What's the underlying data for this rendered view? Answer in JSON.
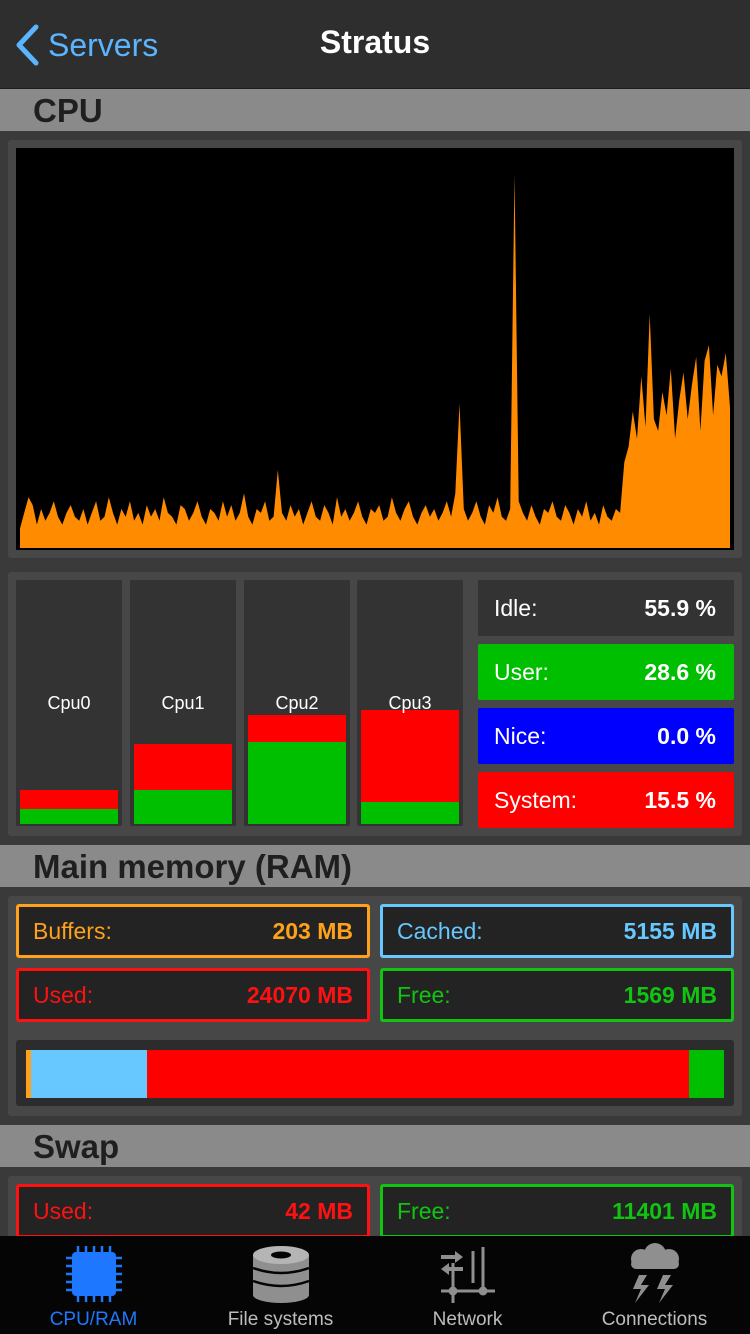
{
  "nav": {
    "back_label": "Servers",
    "title": "Stratus"
  },
  "sections": {
    "cpu": "CPU",
    "ram": "Main memory (RAM)",
    "swap": "Swap"
  },
  "cpu_chart": {
    "color": "#ff8c00",
    "samples": [
      5,
      9,
      13,
      11,
      6,
      10,
      7,
      9,
      12,
      8,
      6,
      9,
      11,
      8,
      7,
      10,
      6,
      9,
      12,
      7,
      8,
      13,
      9,
      6,
      10,
      8,
      12,
      7,
      9,
      6,
      11,
      8,
      10,
      7,
      13,
      9,
      8,
      6,
      11,
      10,
      7,
      9,
      12,
      8,
      6,
      10,
      9,
      7,
      12,
      8,
      11,
      7,
      9,
      14,
      8,
      6,
      10,
      9,
      12,
      7,
      8,
      20,
      9,
      7,
      11,
      8,
      10,
      6,
      9,
      12,
      8,
      7,
      11,
      9,
      6,
      13,
      8,
      10,
      7,
      9,
      12,
      8,
      6,
      10,
      9,
      11,
      7,
      8,
      13,
      9,
      7,
      10,
      12,
      8,
      6,
      9,
      11,
      8,
      10,
      7,
      9,
      12,
      8,
      14,
      37,
      10,
      7,
      9,
      12,
      8,
      6,
      11,
      9,
      13,
      8,
      7,
      10,
      96,
      12,
      9,
      7,
      11,
      8,
      6,
      10,
      9,
      12,
      8,
      7,
      11,
      9,
      6,
      10,
      8,
      12,
      7,
      9,
      6,
      11,
      8,
      7,
      10,
      9,
      22,
      26,
      35,
      28,
      44,
      31,
      60,
      33,
      30,
      40,
      34,
      46,
      28,
      38,
      45,
      33,
      42,
      49,
      30,
      48,
      52,
      34,
      47,
      44,
      50,
      36
    ],
    "max": 100
  },
  "cores": [
    {
      "name": "Cpu0",
      "user": 6,
      "system": 8
    },
    {
      "name": "Cpu1",
      "user": 14,
      "system": 19
    },
    {
      "name": "Cpu2",
      "user": 34,
      "system": 11
    },
    {
      "name": "Cpu3",
      "user": 9,
      "system": 38
    }
  ],
  "cpu_stats": [
    {
      "label": "Idle:",
      "value": "55.9 %",
      "bg": "#333333"
    },
    {
      "label": "User:",
      "value": "28.6 %",
      "bg": "#00bf00"
    },
    {
      "label": "Nice:",
      "value": "0.0 %",
      "bg": "#0000ff"
    },
    {
      "label": "System:",
      "value": "15.5 %",
      "bg": "#ff0000"
    }
  ],
  "ram": {
    "buffers": {
      "label": "Buffers:",
      "value": "203 MB",
      "color": "#ffa11a"
    },
    "cached": {
      "label": "Cached:",
      "value": "5155 MB",
      "color": "#66c8ff"
    },
    "used": {
      "label": "Used:",
      "value": "24070 MB",
      "color": "#ff1111"
    },
    "free": {
      "label": "Free:",
      "value": "1569 MB",
      "color": "#11c411"
    }
  },
  "ram_bar": [
    {
      "name": "buffers",
      "mb": 203,
      "color": "#ffa11a"
    },
    {
      "name": "cached",
      "mb": 5155,
      "color": "#66c8ff"
    },
    {
      "name": "used",
      "mb": 24070,
      "color": "#ff0000"
    },
    {
      "name": "free",
      "mb": 1569,
      "color": "#00bf00"
    }
  ],
  "swap": {
    "used": {
      "label": "Used:",
      "value": "42 MB",
      "color": "#ff1111"
    },
    "free": {
      "label": "Free:",
      "value": "11401 MB",
      "color": "#11c411"
    }
  },
  "tabs": [
    {
      "label": "CPU/RAM",
      "icon": "cpu-chip-icon",
      "active": true
    },
    {
      "label": "File systems",
      "icon": "database-icon",
      "active": false
    },
    {
      "label": "Network",
      "icon": "network-icon",
      "active": false
    },
    {
      "label": "Connections",
      "icon": "storm-cloud-icon",
      "active": false
    }
  ]
}
